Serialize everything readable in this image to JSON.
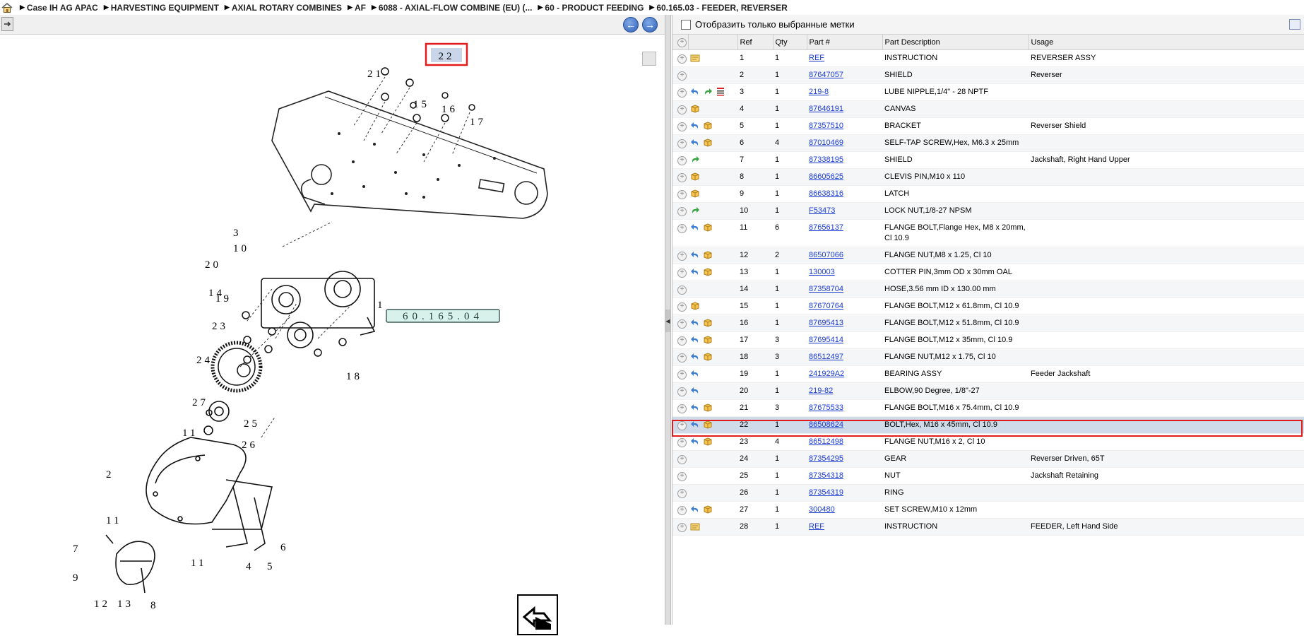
{
  "breadcrumb": [
    "Case IH AG APAC",
    "HARVESTING EQUIPMENT",
    "AXIAL ROTARY COMBINES",
    "AF",
    "6088 - AXIAL-FLOW COMBINE (EU) (...",
    "60 - PRODUCT FEEDING",
    "60.165.03 - FEEDER, REVERSER"
  ],
  "filter_label": "Отобразить только выбранные метки",
  "columns": {
    "ref": "Ref",
    "qty": "Qty",
    "part": "Part #",
    "desc": "Part Description",
    "usage": "Usage"
  },
  "drawing": {
    "ref_box": "60.165.04",
    "highlight_label": "22",
    "labels": [
      "21",
      "22",
      "15",
      "16",
      "17",
      "3",
      "10",
      "20",
      "14",
      "19",
      "1",
      "23",
      "24",
      "18",
      "27",
      "25",
      "11",
      "26",
      "2",
      "11",
      "7",
      "9",
      "12",
      "13",
      "8",
      "11",
      "4",
      "5",
      "6"
    ]
  },
  "rows": [
    {
      "ref": "1",
      "qty": "1",
      "part": "REF",
      "desc": "INSTRUCTION",
      "usage": "REVERSER ASSY",
      "icons": [
        "doc-icon"
      ]
    },
    {
      "ref": "2",
      "qty": "1",
      "part": "87647057",
      "desc": "SHIELD",
      "usage": "Reverser",
      "icons": []
    },
    {
      "ref": "3",
      "qty": "1",
      "part": "219-8",
      "desc": "LUBE NIPPLE,1/4\" - 28 NPTF",
      "usage": "",
      "icons": [
        "back-arrow-icon",
        "forward-arrow-icon",
        "list-icon"
      ]
    },
    {
      "ref": "4",
      "qty": "1",
      "part": "87646191",
      "desc": "CANVAS",
      "usage": "",
      "icons": [
        "box-icon"
      ]
    },
    {
      "ref": "5",
      "qty": "1",
      "part": "87357510",
      "desc": "BRACKET",
      "usage": "Reverser Shield",
      "icons": [
        "back-arrow-icon",
        "box-icon"
      ]
    },
    {
      "ref": "6",
      "qty": "4",
      "part": "87010469",
      "desc": "SELF-TAP SCREW,Hex, M6.3 x 25mm",
      "usage": "",
      "icons": [
        "back-arrow-icon",
        "box-icon"
      ]
    },
    {
      "ref": "7",
      "qty": "1",
      "part": "87338195",
      "desc": "SHIELD",
      "usage": "Jackshaft, Right Hand Upper",
      "icons": [
        "forward-arrow-icon"
      ]
    },
    {
      "ref": "8",
      "qty": "1",
      "part": "86605625",
      "desc": "CLEVIS PIN,M10 x 110",
      "usage": "",
      "icons": [
        "box-icon"
      ]
    },
    {
      "ref": "9",
      "qty": "1",
      "part": "86638316",
      "desc": "LATCH",
      "usage": "",
      "icons": [
        "box-icon"
      ]
    },
    {
      "ref": "10",
      "qty": "1",
      "part": "F53473",
      "desc": "LOCK NUT,1/8-27 NPSM",
      "usage": "",
      "icons": [
        "forward-arrow-icon"
      ]
    },
    {
      "ref": "11",
      "qty": "6",
      "part": "87656137",
      "desc": "FLANGE BOLT,Flange Hex, M8 x 20mm, Cl 10.9",
      "usage": "",
      "icons": [
        "back-arrow-icon",
        "box-icon"
      ]
    },
    {
      "ref": "12",
      "qty": "2",
      "part": "86507066",
      "desc": "FLANGE NUT,M8 x 1.25, Cl 10",
      "usage": "",
      "icons": [
        "back-arrow-icon",
        "box-icon"
      ]
    },
    {
      "ref": "13",
      "qty": "1",
      "part": "130003",
      "desc": "COTTER PIN,3mm OD x 30mm OAL",
      "usage": "",
      "icons": [
        "back-arrow-icon",
        "box-icon"
      ]
    },
    {
      "ref": "14",
      "qty": "1",
      "part": "87358704",
      "desc": "HOSE,3.56 mm ID x 130.00 mm",
      "usage": "",
      "icons": []
    },
    {
      "ref": "15",
      "qty": "1",
      "part": "87670764",
      "desc": "FLANGE BOLT,M12 x 61.8mm, Cl 10.9",
      "usage": "",
      "icons": [
        "box-icon"
      ]
    },
    {
      "ref": "16",
      "qty": "1",
      "part": "87695413",
      "desc": "FLANGE BOLT,M12 x 51.8mm, Cl 10.9",
      "usage": "",
      "icons": [
        "back-arrow-icon",
        "box-icon"
      ]
    },
    {
      "ref": "17",
      "qty": "3",
      "part": "87695414",
      "desc": "FLANGE BOLT,M12 x 35mm, Cl 10.9",
      "usage": "",
      "icons": [
        "back-arrow-icon",
        "box-icon"
      ]
    },
    {
      "ref": "18",
      "qty": "3",
      "part": "86512497",
      "desc": "FLANGE NUT,M12 x 1.75, Cl 10",
      "usage": "",
      "icons": [
        "back-arrow-icon",
        "box-icon"
      ]
    },
    {
      "ref": "19",
      "qty": "1",
      "part": "241929A2",
      "desc": "BEARING ASSY",
      "usage": "Feeder Jackshaft",
      "icons": [
        "back-arrow-icon"
      ]
    },
    {
      "ref": "20",
      "qty": "1",
      "part": "219-82",
      "desc": "ELBOW,90 Degree, 1/8\"-27",
      "usage": "",
      "icons": [
        "back-arrow-icon"
      ]
    },
    {
      "ref": "21",
      "qty": "3",
      "part": "87675533",
      "desc": "FLANGE BOLT,M16 x 75.4mm, Cl 10.9",
      "usage": "",
      "icons": [
        "back-arrow-icon",
        "box-icon"
      ]
    },
    {
      "ref": "22",
      "qty": "1",
      "part": "86508624",
      "desc": "BOLT,Hex, M16 x 45mm, Cl 10.9",
      "usage": "",
      "icons": [
        "back-arrow-icon",
        "box-icon"
      ],
      "selected": true
    },
    {
      "ref": "23",
      "qty": "4",
      "part": "86512498",
      "desc": "FLANGE NUT,M16 x 2, Cl 10",
      "usage": "",
      "icons": [
        "back-arrow-icon",
        "box-icon"
      ]
    },
    {
      "ref": "24",
      "qty": "1",
      "part": "87354295",
      "desc": "GEAR",
      "usage": "Reverser Driven, 65T",
      "icons": []
    },
    {
      "ref": "25",
      "qty": "1",
      "part": "87354318",
      "desc": "NUT",
      "usage": "Jackshaft Retaining",
      "icons": []
    },
    {
      "ref": "26",
      "qty": "1",
      "part": "87354319",
      "desc": "RING",
      "usage": "",
      "icons": []
    },
    {
      "ref": "27",
      "qty": "1",
      "part": "300480",
      "desc": "SET SCREW,M10 x 12mm",
      "usage": "",
      "icons": [
        "back-arrow-icon",
        "box-icon"
      ]
    },
    {
      "ref": "28",
      "qty": "1",
      "part": "REF",
      "desc": "INSTRUCTION",
      "usage": "FEEDER, Left Hand Side",
      "icons": [
        "doc-icon"
      ]
    }
  ]
}
